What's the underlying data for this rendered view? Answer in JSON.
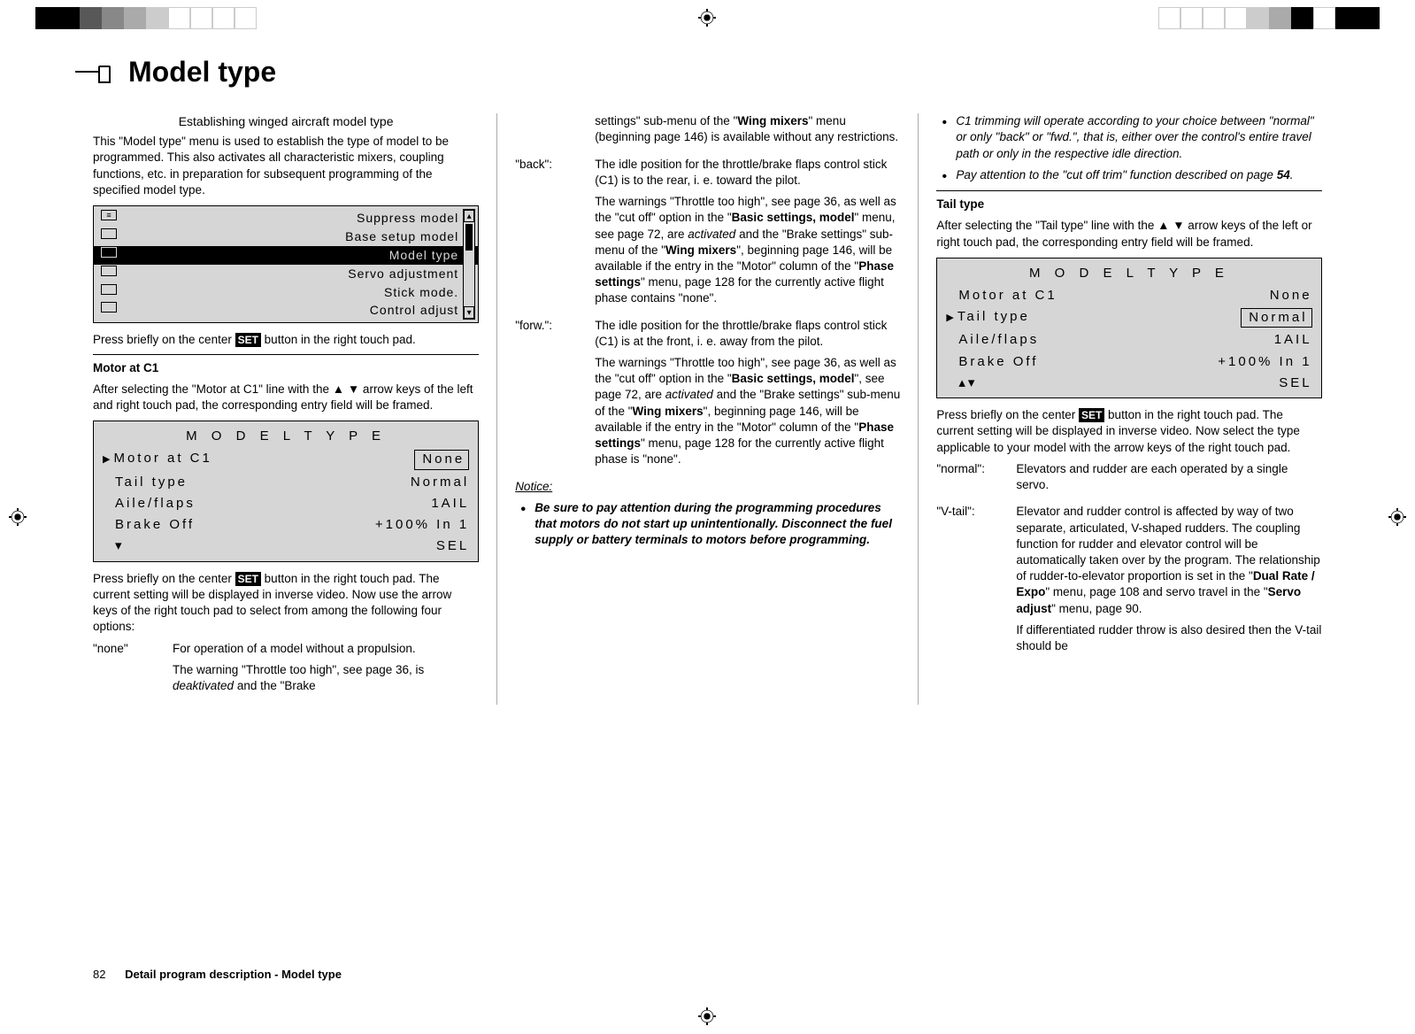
{
  "heading": "Model type",
  "subtitle": "Establishing winged aircraft model type",
  "col1": {
    "intro": "This \"Model type\" menu is used to establish the type of model to be programmed. This also activates all characteristic mixers, coupling functions, etc. in preparation for subsequent programming of the specified model type.",
    "menu": {
      "items": [
        "Suppress model",
        "Base setup model",
        "Model type",
        "Servo adjustment",
        "Stick mode.",
        "Control adjust"
      ],
      "selected": 2
    },
    "after_menu_a": "Press briefly on the center ",
    "after_menu_b": " button in the right touch pad.",
    "motor_heading": "Motor at C1",
    "motor_p": "After selecting the \"Motor at C1\" line with the ▲ ▼ arrow keys of the left and right touch pad, the corresponding entry field will be framed.",
    "lcd1": {
      "title": "M O D E L T Y P E",
      "rows": [
        {
          "l": "Motor  at  C1",
          "r": "None",
          "ptr": true,
          "box": true
        },
        {
          "l": "Tail type",
          "r": "Normal"
        },
        {
          "l": "Aile/flaps",
          "r": "1AIL"
        },
        {
          "l": "Brake Off",
          "r": "+100%   In 1"
        },
        {
          "l": "▾",
          "r": "SEL"
        }
      ]
    },
    "after_lcd1": "Press briefly on the center ",
    "after_lcd1b": " button in the right touch pad. The current setting will be displayed in inverse video. Now use the arrow keys of the right touch pad to select from among the following four options:",
    "none": {
      "dt": "\"none\"",
      "p1": "For operation of a model without a propulsion.",
      "p2a": "The warning \"Throttle too high\", see page 36, is ",
      "p2_deakt": "deaktivated",
      "p2b": " and the \"Brake"
    }
  },
  "col2": {
    "cont_a": "settings\" sub-menu of the \"",
    "cont_b": "Wing mixers",
    "cont_c": "\" menu (beginning page 146) is available without any restrictions.",
    "back": {
      "dt": "\"back\":",
      "p1": "The idle position for the throttle/brake flaps control stick (C1) is to the rear, i. e. toward the pilot.",
      "p2a": "The warnings \"Throttle too high\", see page 36, as well as the \"cut off\" option in the \"",
      "p2_bsm": "Basic settings, model",
      "p2b": "\" menu, see page 72, are ",
      "p2_act": "activated",
      "p2c": " and the \"Brake settings\" sub-menu of the \"",
      "p2_wm": "Wing mixers",
      "p2d": "\", beginning page 146, will be available if the entry in the \"Motor\" column of the \"",
      "p2_ps": "Phase settings",
      "p2e": "\" menu, page 128 for the currently active flight phase contains \"none\"."
    },
    "forw": {
      "dt": "\"forw.\":",
      "p1": "The idle position for the throttle/brake flaps control stick (C1) is at the front, i. e. away from the pilot.",
      "p2a": "The warnings \"Throttle too high\", see page 36, as well as the \"cut off\" option in the \"",
      "p2_bsm": "Basic settings, model",
      "p2b": "\", see page 72, are ",
      "p2_act": "activated",
      "p2c": " and the \"Brake settings\" sub-menu of the \"",
      "p2_wm": "Wing mixers",
      "p2d": "\", beginning page 146, will be available if the entry in the \"Motor\" column of the \"",
      "p2_ps": "Phase settings",
      "p2e": "\" menu, page 128 for the currently active flight phase is \"none\"."
    },
    "notice_h": "Notice:",
    "notice1": "Be sure to pay attention during the programming procedures that motors do not start up unintentionally. Disconnect the fuel supply or battery terminals to motors before programming."
  },
  "col3": {
    "note2": "C1 trimming will operate according to your choice between \"normal\" or only \"back\" or \"fwd.\", that is, either over the control's entire travel path or only in the respective idle direction.",
    "note3a": "Pay attention to the \"cut off trim\" function described on page ",
    "note3_pg": "54",
    "note3b": ".",
    "tail_h": "Tail type",
    "tail_p": "After selecting the \"Tail type\" line with the ▲ ▼ arrow keys of the left or right touch pad, the corresponding entry field will be framed.",
    "lcd2": {
      "title": "M O D E L T Y P E",
      "rows": [
        {
          "l": "Motor  at  C1",
          "r": "None"
        },
        {
          "l": "Tail type",
          "r": "Normal",
          "ptr": true,
          "box": true
        },
        {
          "l": "Aile/flaps",
          "r": "1AIL"
        },
        {
          "l": "Brake Off",
          "r": "+100%   In 1"
        },
        {
          "l": "▴▾",
          "r": "SEL"
        }
      ]
    },
    "after_lcd2a": "Press briefly on the center ",
    "after_lcd2b": " button in the right touch pad. The current setting will be displayed in inverse video. Now select the type applicable to your model with the arrow keys of the right touch pad.",
    "normal": {
      "dt": "\"normal\":",
      "dd": "Elevators and rudder are each operated by a single servo."
    },
    "vtail": {
      "dt": "\"V-tail\":",
      "p1a": "Elevator and rudder control is affected by way of two separate, articulated, V-shaped rudders. The coupling function for rudder and elevator control will be automatically taken over by the program. The relationship of rudder-to-elevator proportion is set in the \"",
      "p1_dr": "Dual Rate / Expo",
      "p1b": "\" menu, page 108 and servo travel in the \"",
      "p1_sa": "Servo adjust",
      "p1c": "\" menu, page 90.",
      "p2": "If differentiated rudder throw is also desired then the V-tail should be"
    }
  },
  "set_label": "SET",
  "footer": {
    "pn": "82",
    "title": "Detail program description - Model type"
  }
}
